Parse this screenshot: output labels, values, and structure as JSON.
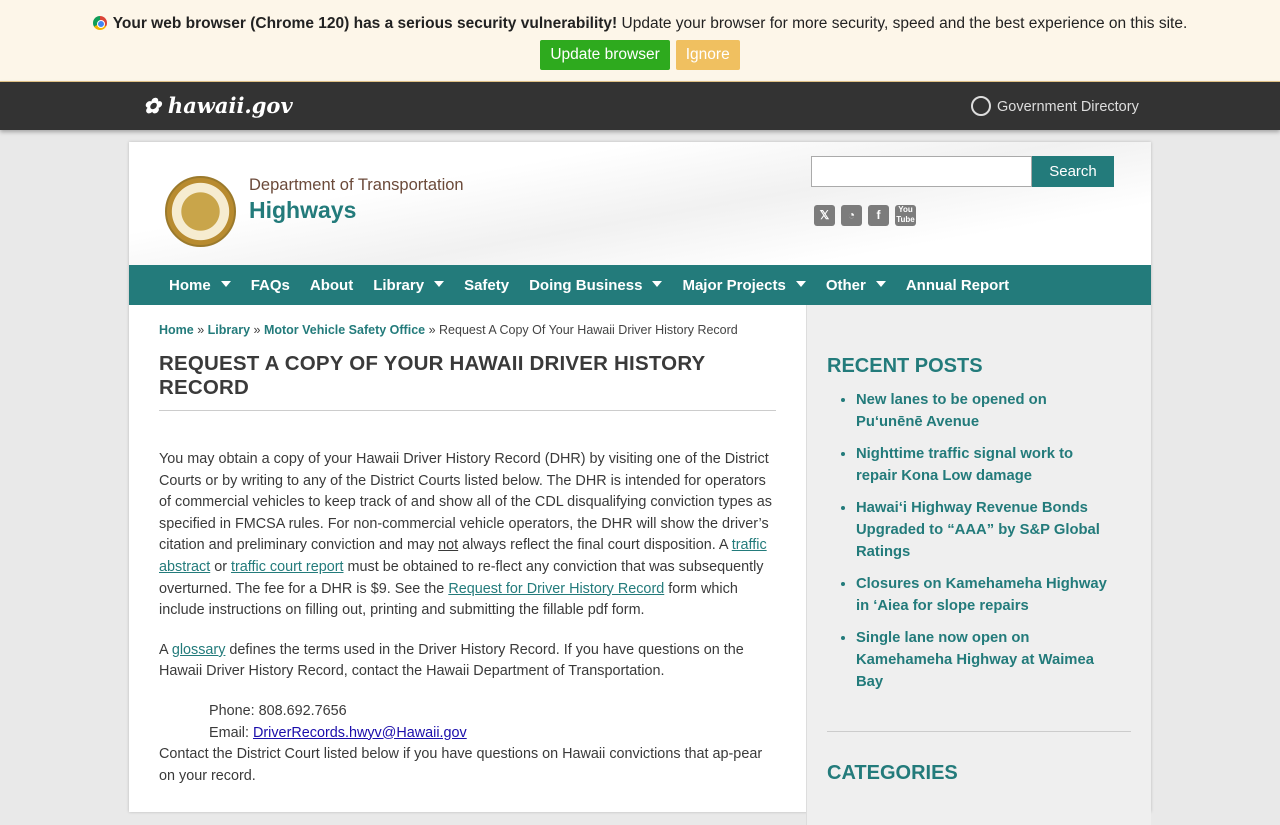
{
  "alert": {
    "bold": "Your web browser (Chrome 120) has a serious security vulnerability!",
    "text": " Update your browser for more security, speed and the best experience on this site.",
    "update": "Update browser",
    "ignore": "Ignore"
  },
  "gov": {
    "logo": "hawaii.gov",
    "directory": "Government Directory"
  },
  "header": {
    "dept": "Department of Transportation",
    "site": "Highways",
    "search_button": "Search",
    "search_value": "",
    "social": [
      "X",
      "RSS",
      "f",
      "YouTube"
    ]
  },
  "nav": [
    "Home",
    "FAQs",
    "About",
    "Library",
    "Safety",
    "Doing Business",
    "Major Projects",
    "Other",
    "Annual Report"
  ],
  "breadcrumb": [
    "Home",
    "Library",
    "Motor Vehicle Safety Office",
    "Request A Copy Of Your Hawaii Driver History Record"
  ],
  "title": "REQUEST A COPY OF YOUR HAWAII DRIVER HISTORY RECORD",
  "p1": {
    "a": "You may obtain a copy of your Hawaii Driver History Record (DHR) by visiting one of the District Courts or by writing to any of the District Courts listed below. The DHR is intended for operators of commercial vehicles to keep track of and show all of the CDL disqualifying conviction types as specified in FMCSA rules. For non-commercial vehicle operators, the DHR will show the driver’s citation and preliminary conviction and may ",
    "not": "not",
    "b": " always reflect the final court disposition. A ",
    "link1": "traffic abstract",
    "c": " or ",
    "link2": "traffic court report",
    "d": " must be obtained to re-flect any conviction that was subsequently overturned. The fee for a DHR is $9. See the ",
    "link3": "Request for Driver History Record",
    "e": " form which include instructions on filling out, printing and submitting the fillable pdf form."
  },
  "p2": {
    "a": "A ",
    "link": "glossary",
    "b": " defines the terms used in the Driver History Record. If you have questions on the Hawaii Driver History Record, contact the Hawaii Department of Transportation."
  },
  "contact": {
    "phone": "Phone: 808.692.7656",
    "email_label": "Email: ",
    "email": "DriverRecords.hwyv@Hawaii.gov"
  },
  "after": "Contact the District Court listed below if you have questions on Hawaii convictions that ap-pear on your record.",
  "sidebar": {
    "recent_title": "RECENT POSTS",
    "posts": [
      "New lanes to be opened on Pu‘unēnē Avenue",
      "Nighttime traffic signal work to repair Kona Low damage",
      "Hawai‘i Highway Revenue Bonds Upgraded to “AAA” by S&P Global Ratings",
      "Closures on Kamehameha Highway in ‘Aiea for slope repairs",
      "Single lane now open on Kamehameha Highway at Waimea Bay"
    ],
    "categories_title": "CATEGORIES"
  }
}
